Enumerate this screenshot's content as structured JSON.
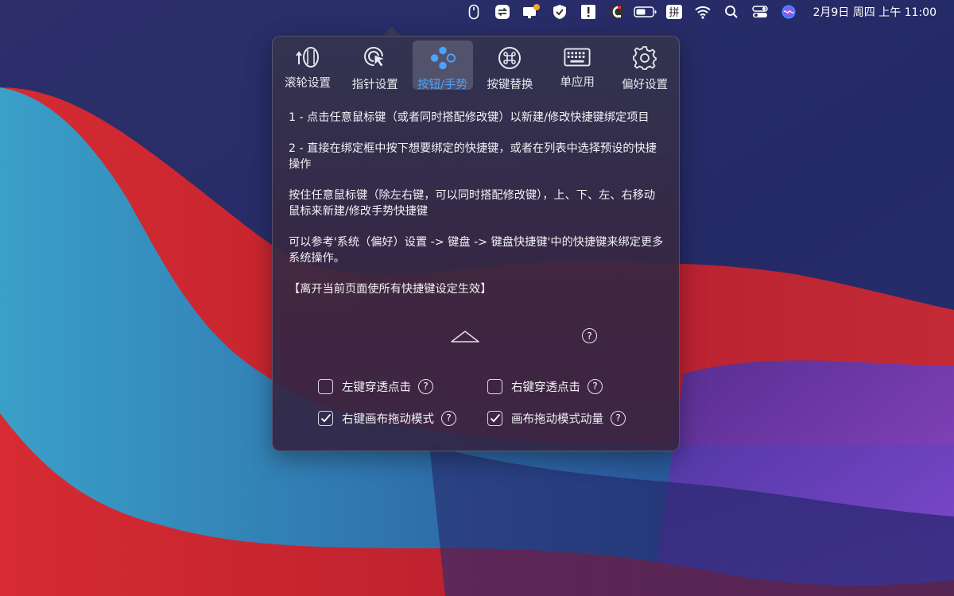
{
  "menubar": {
    "icons": [
      "mouse-icon",
      "sync-arrows-icon",
      "screen-notification-icon",
      "shield-check-icon",
      "alert-box-icon",
      "magnet-icon",
      "battery-icon",
      "input-method-pinyin-icon",
      "wifi-icon",
      "search-icon",
      "control-center-icon",
      "siri-icon"
    ],
    "input_method_label": "拼",
    "clock": "2月9日 周四 上午 11:00"
  },
  "popover": {
    "tabs": [
      {
        "label": "滚轮设置",
        "icon": "scroll-wheel-icon",
        "active": false
      },
      {
        "label": "指针设置",
        "icon": "pointer-click-icon",
        "active": false
      },
      {
        "label": "按钮/手势",
        "icon": "buttons-gesture-icon",
        "active": true
      },
      {
        "label": "按键替换",
        "icon": "command-key-icon",
        "active": false
      },
      {
        "label": "单应用",
        "icon": "keyboard-icon",
        "active": false
      },
      {
        "label": "偏好设置",
        "icon": "gear-icon",
        "active": false
      }
    ],
    "instructions": [
      "1 - 点击任意鼠标键（或者同时搭配修改键）以新建/修改快捷键绑定项目",
      "2 - 直接在绑定框中按下想要绑定的快捷键，或者在列表中选择预设的快捷操作",
      "按住任意鼠标键（除左右键，可以同时搭配修改键），上、下、左、右移动鼠标来新建/修改手势快捷键",
      "可以参考'系统（偏好）设置 -> 键盘 -> 键盘快捷键'中的快捷键来绑定更多系统操作。",
      "【离开当前页面使所有快捷键设定生效】"
    ],
    "help_glyph": "?",
    "options": [
      {
        "label": "左键穿透点击",
        "checked": false
      },
      {
        "label": "右键穿透点击",
        "checked": false
      },
      {
        "label": "右键画布拖动模式",
        "checked": true
      },
      {
        "label": "画布拖动模式动量",
        "checked": true
      }
    ]
  },
  "colors": {
    "accent": "#4aa3ff",
    "popover_bg": "#343450",
    "text": "#f2f2f5"
  }
}
